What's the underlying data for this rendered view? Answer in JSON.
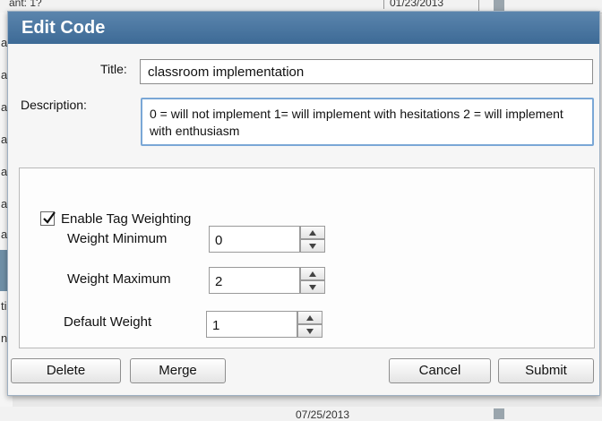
{
  "background": {
    "top_left_text": "ant: 1?",
    "top_date_text": "01/23/2013",
    "bottom_left_text": "",
    "bottom_mid_text": "07/25/2013",
    "left_fragments": [
      "a",
      "a",
      "a",
      "a",
      "a",
      "a",
      "a",
      "ti",
      "n"
    ]
  },
  "dialog": {
    "title": "Edit Code",
    "title_label": "Title:",
    "title_value": "classroom implementation",
    "description_label": "Description:",
    "description_value": "0 = will not implement 1= will implement with hesitations 2 = will implement with enthusiasm",
    "enable_weighting_label": "Enable Tag Weighting",
    "enable_weighting_checked": true,
    "weight_min_label": "Weight Minimum",
    "weight_min_value": "0",
    "weight_max_label": "Weight Maximum",
    "weight_max_value": "2",
    "default_weight_label": "Default Weight",
    "default_weight_value": "1",
    "buttons": {
      "delete": "Delete",
      "merge": "Merge",
      "cancel": "Cancel",
      "submit": "Submit"
    }
  },
  "icons": {
    "checkbox": "checkmark-icon",
    "spin_up": "triangle-up-icon",
    "spin_down": "triangle-down-icon"
  },
  "colors": {
    "titlebar": "#4a76a0",
    "focus_border": "#7aa7d6"
  }
}
